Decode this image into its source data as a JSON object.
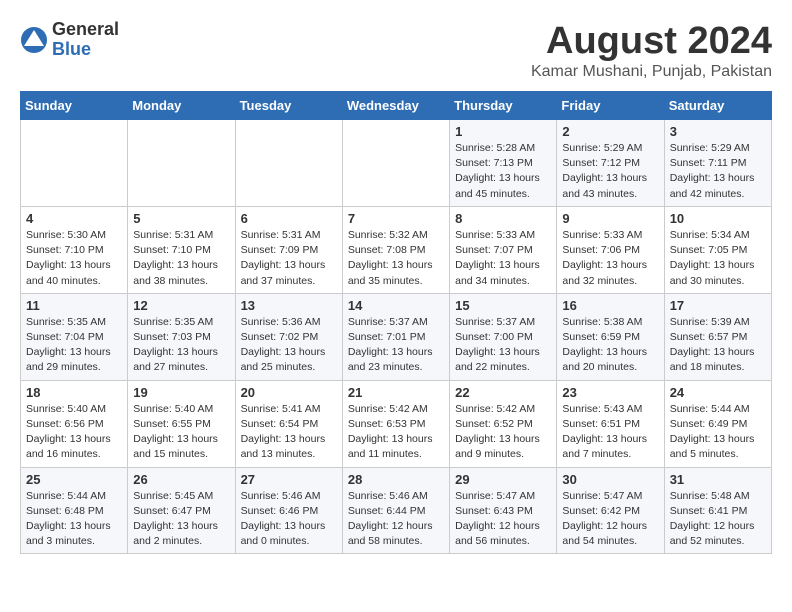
{
  "logo": {
    "general": "General",
    "blue": "Blue"
  },
  "title": "August 2024",
  "subtitle": "Kamar Mushani, Punjab, Pakistan",
  "days_header": [
    "Sunday",
    "Monday",
    "Tuesday",
    "Wednesday",
    "Thursday",
    "Friday",
    "Saturday"
  ],
  "weeks": [
    [
      {
        "num": "",
        "info": ""
      },
      {
        "num": "",
        "info": ""
      },
      {
        "num": "",
        "info": ""
      },
      {
        "num": "",
        "info": ""
      },
      {
        "num": "1",
        "info": "Sunrise: 5:28 AM\nSunset: 7:13 PM\nDaylight: 13 hours\nand 45 minutes."
      },
      {
        "num": "2",
        "info": "Sunrise: 5:29 AM\nSunset: 7:12 PM\nDaylight: 13 hours\nand 43 minutes."
      },
      {
        "num": "3",
        "info": "Sunrise: 5:29 AM\nSunset: 7:11 PM\nDaylight: 13 hours\nand 42 minutes."
      }
    ],
    [
      {
        "num": "4",
        "info": "Sunrise: 5:30 AM\nSunset: 7:10 PM\nDaylight: 13 hours\nand 40 minutes."
      },
      {
        "num": "5",
        "info": "Sunrise: 5:31 AM\nSunset: 7:10 PM\nDaylight: 13 hours\nand 38 minutes."
      },
      {
        "num": "6",
        "info": "Sunrise: 5:31 AM\nSunset: 7:09 PM\nDaylight: 13 hours\nand 37 minutes."
      },
      {
        "num": "7",
        "info": "Sunrise: 5:32 AM\nSunset: 7:08 PM\nDaylight: 13 hours\nand 35 minutes."
      },
      {
        "num": "8",
        "info": "Sunrise: 5:33 AM\nSunset: 7:07 PM\nDaylight: 13 hours\nand 34 minutes."
      },
      {
        "num": "9",
        "info": "Sunrise: 5:33 AM\nSunset: 7:06 PM\nDaylight: 13 hours\nand 32 minutes."
      },
      {
        "num": "10",
        "info": "Sunrise: 5:34 AM\nSunset: 7:05 PM\nDaylight: 13 hours\nand 30 minutes."
      }
    ],
    [
      {
        "num": "11",
        "info": "Sunrise: 5:35 AM\nSunset: 7:04 PM\nDaylight: 13 hours\nand 29 minutes."
      },
      {
        "num": "12",
        "info": "Sunrise: 5:35 AM\nSunset: 7:03 PM\nDaylight: 13 hours\nand 27 minutes."
      },
      {
        "num": "13",
        "info": "Sunrise: 5:36 AM\nSunset: 7:02 PM\nDaylight: 13 hours\nand 25 minutes."
      },
      {
        "num": "14",
        "info": "Sunrise: 5:37 AM\nSunset: 7:01 PM\nDaylight: 13 hours\nand 23 minutes."
      },
      {
        "num": "15",
        "info": "Sunrise: 5:37 AM\nSunset: 7:00 PM\nDaylight: 13 hours\nand 22 minutes."
      },
      {
        "num": "16",
        "info": "Sunrise: 5:38 AM\nSunset: 6:59 PM\nDaylight: 13 hours\nand 20 minutes."
      },
      {
        "num": "17",
        "info": "Sunrise: 5:39 AM\nSunset: 6:57 PM\nDaylight: 13 hours\nand 18 minutes."
      }
    ],
    [
      {
        "num": "18",
        "info": "Sunrise: 5:40 AM\nSunset: 6:56 PM\nDaylight: 13 hours\nand 16 minutes."
      },
      {
        "num": "19",
        "info": "Sunrise: 5:40 AM\nSunset: 6:55 PM\nDaylight: 13 hours\nand 15 minutes."
      },
      {
        "num": "20",
        "info": "Sunrise: 5:41 AM\nSunset: 6:54 PM\nDaylight: 13 hours\nand 13 minutes."
      },
      {
        "num": "21",
        "info": "Sunrise: 5:42 AM\nSunset: 6:53 PM\nDaylight: 13 hours\nand 11 minutes."
      },
      {
        "num": "22",
        "info": "Sunrise: 5:42 AM\nSunset: 6:52 PM\nDaylight: 13 hours\nand 9 minutes."
      },
      {
        "num": "23",
        "info": "Sunrise: 5:43 AM\nSunset: 6:51 PM\nDaylight: 13 hours\nand 7 minutes."
      },
      {
        "num": "24",
        "info": "Sunrise: 5:44 AM\nSunset: 6:49 PM\nDaylight: 13 hours\nand 5 minutes."
      }
    ],
    [
      {
        "num": "25",
        "info": "Sunrise: 5:44 AM\nSunset: 6:48 PM\nDaylight: 13 hours\nand 3 minutes."
      },
      {
        "num": "26",
        "info": "Sunrise: 5:45 AM\nSunset: 6:47 PM\nDaylight: 13 hours\nand 2 minutes."
      },
      {
        "num": "27",
        "info": "Sunrise: 5:46 AM\nSunset: 6:46 PM\nDaylight: 13 hours\nand 0 minutes."
      },
      {
        "num": "28",
        "info": "Sunrise: 5:46 AM\nSunset: 6:44 PM\nDaylight: 12 hours\nand 58 minutes."
      },
      {
        "num": "29",
        "info": "Sunrise: 5:47 AM\nSunset: 6:43 PM\nDaylight: 12 hours\nand 56 minutes."
      },
      {
        "num": "30",
        "info": "Sunrise: 5:47 AM\nSunset: 6:42 PM\nDaylight: 12 hours\nand 54 minutes."
      },
      {
        "num": "31",
        "info": "Sunrise: 5:48 AM\nSunset: 6:41 PM\nDaylight: 12 hours\nand 52 minutes."
      }
    ]
  ]
}
